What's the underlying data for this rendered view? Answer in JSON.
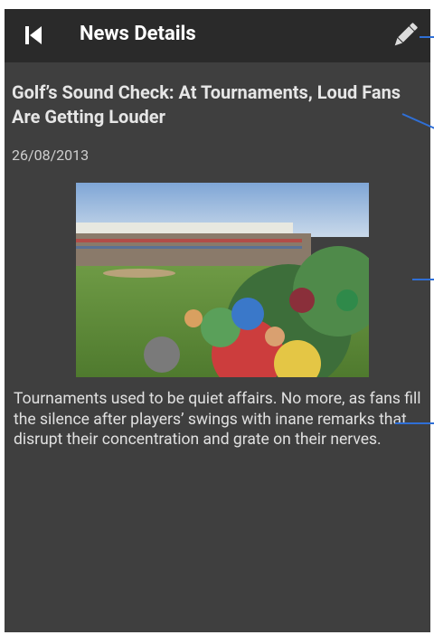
{
  "toolbar": {
    "title": "News Details",
    "back_icon": "skip-back-icon",
    "edit_icon": "pencil-icon"
  },
  "article": {
    "title": "Golf’s Sound Check: At Tournaments, Loud Fans Are Getting Louder",
    "date": "26/08/2013",
    "summary": "Tournaments used to be quiet affairs. No more, as fans fill the silence after players’ swings with inane remarks that disrupt their concentration and grate on their nerves."
  },
  "colors": {
    "toolbar_bg": "#2a2a2a",
    "content_bg": "#3f3f3f",
    "annotation_line": "#2f6fd6"
  }
}
